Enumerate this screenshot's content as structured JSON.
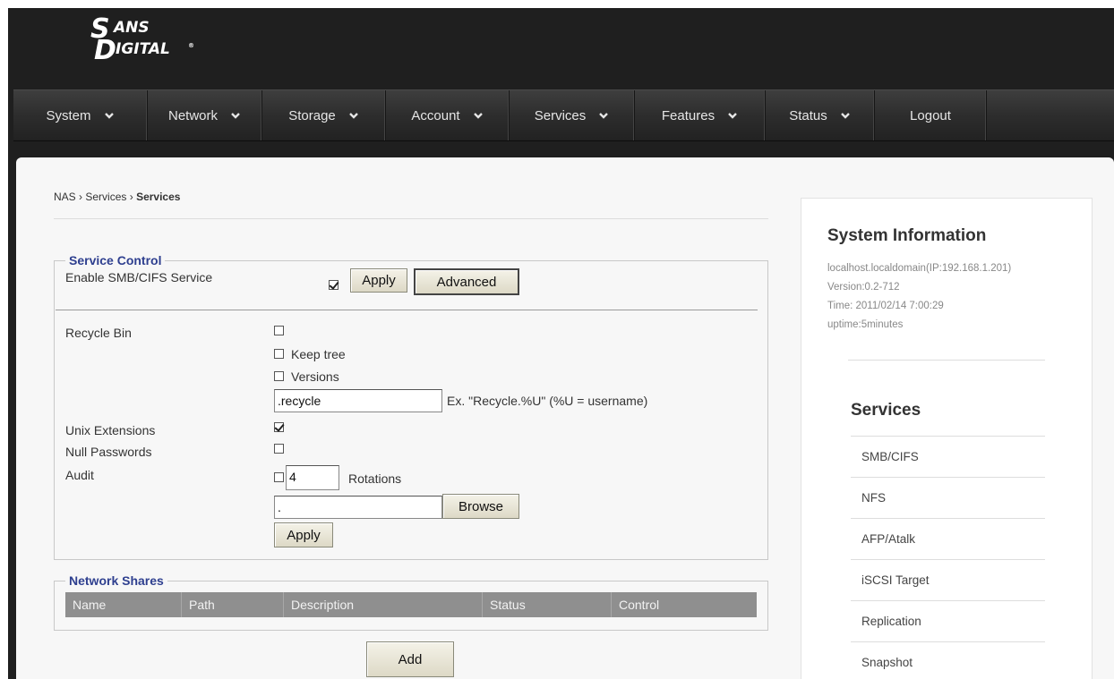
{
  "logo": {
    "big_s": "S",
    "ans": "ANS",
    "big_d": "D",
    "igital": "IGITAL",
    "reg": "®"
  },
  "nav": [
    {
      "label": "System",
      "dropdown": true
    },
    {
      "label": "Network",
      "dropdown": true
    },
    {
      "label": "Storage",
      "dropdown": true
    },
    {
      "label": "Account",
      "dropdown": true
    },
    {
      "label": "Services",
      "dropdown": true
    },
    {
      "label": "Features",
      "dropdown": true
    },
    {
      "label": "Status",
      "dropdown": true
    },
    {
      "label": "Logout",
      "dropdown": false
    }
  ],
  "breadcrumb": {
    "root": "NAS",
    "sep": "›",
    "parent": "Services",
    "current": "Services"
  },
  "service_control": {
    "legend": "Service Control",
    "enable_label": "Enable SMB/CIFS Service",
    "enable_checked": true,
    "apply_label": "Apply",
    "advanced_label": "Advanced",
    "recycle_bin_label": "Recycle Bin",
    "recycle_bin_checked": false,
    "keep_tree_label": "Keep tree",
    "keep_tree_checked": false,
    "versions_label": "Versions",
    "versions_checked": false,
    "recycle_dir_value": ".recycle",
    "recycle_hint": "Ex. \"Recycle.%U\" (%U = username)",
    "unix_ext_label": "Unix Extensions",
    "unix_ext_checked": true,
    "null_pw_label": "Null Passwords",
    "null_pw_checked": false,
    "audit_label": "Audit",
    "audit_checked": false,
    "rotations_value": "4",
    "rotations_label": "Rotations",
    "audit_path_value": ".",
    "browse_label": "Browse",
    "apply2_label": "Apply"
  },
  "network_shares": {
    "legend": "Network Shares",
    "columns": [
      "Name",
      "Path",
      "Description",
      "Status",
      "Control"
    ],
    "add_label": "Add"
  },
  "sidebar": {
    "sys_title": "System Information",
    "host": "localhost.localdomain(IP:192.168.1.201)",
    "version": "Version:0.2-712",
    "time": "Time: 2011/02/14 7:00:29",
    "uptime": "uptime:5minutes",
    "services_title": "Services",
    "services": [
      "SMB/CIFS",
      "NFS",
      "AFP/Atalk",
      "iSCSI Target",
      "Replication",
      "Snapshot"
    ]
  },
  "colors": {
    "legend": "#2e3f8f",
    "nav_bg": "#2d2d2d",
    "frame_bg": "#1f1f1f",
    "table_header": "#8f8f8f"
  }
}
